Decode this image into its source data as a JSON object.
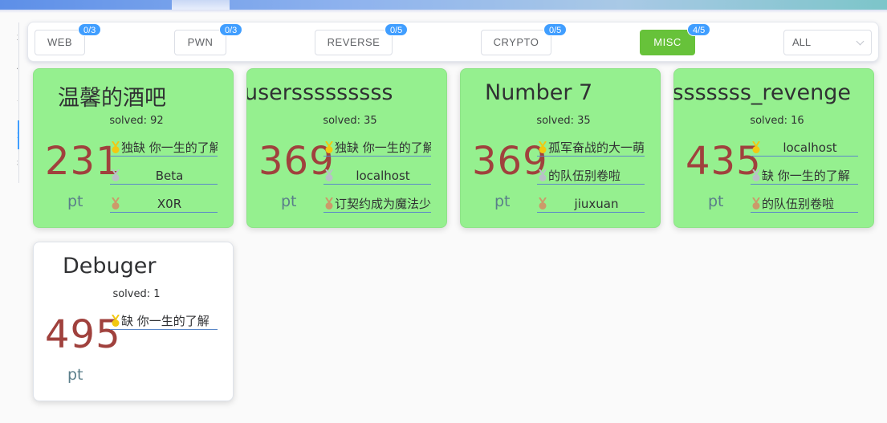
{
  "sidebar": {
    "items": [
      {
        "label": "题"
      },
      {
        "label": "伍"
      },
      {
        "label": "告"
      },
      {
        "label": "题"
      },
      {
        "label": "行"
      }
    ]
  },
  "filter": {
    "categories": [
      {
        "label": "WEB",
        "count": "0/3"
      },
      {
        "label": "PWN",
        "count": "0/3"
      },
      {
        "label": "REVERSE",
        "count": "0/5"
      },
      {
        "label": "CRYPTO",
        "count": "0/5"
      },
      {
        "label": "MISC",
        "count": "4/5"
      }
    ],
    "select_value": "ALL"
  },
  "medal_colors": {
    "gold": "#f2c811",
    "silver": "#b9c0c8",
    "bronze": "#cc9a6a"
  },
  "challenges": [
    {
      "title": "温馨的酒吧",
      "solved": "solved: 92",
      "points": "231",
      "unit": "pt",
      "solvers": [
        "独缺 你一生的了解",
        "Beta",
        "X0R"
      ]
    },
    {
      "title": "usersssssssss",
      "solved": "solved: 35",
      "points": "369",
      "unit": "pt",
      "solvers": [
        "独缺 你一生的了解",
        "localhost",
        "订契约成为魔法少女"
      ]
    },
    {
      "title": "Number 7",
      "solved": "solved: 35",
      "points": "369",
      "unit": "pt",
      "solvers": [
        "孤军奋战的大一萌新",
        "的队伍别卷啦",
        "jiuxuan"
      ]
    },
    {
      "title": "usersssssssss_revenge",
      "solved": "solved: 16",
      "points": "435",
      "unit": "pt",
      "solvers": [
        "localhost",
        "缺 你一生的了解",
        "的队伍别卷啦"
      ]
    },
    {
      "title": "Debuger",
      "solved": "solved: 1",
      "points": "495",
      "unit": "pt",
      "solvers": [
        "缺 你一生的了解"
      ]
    }
  ]
}
